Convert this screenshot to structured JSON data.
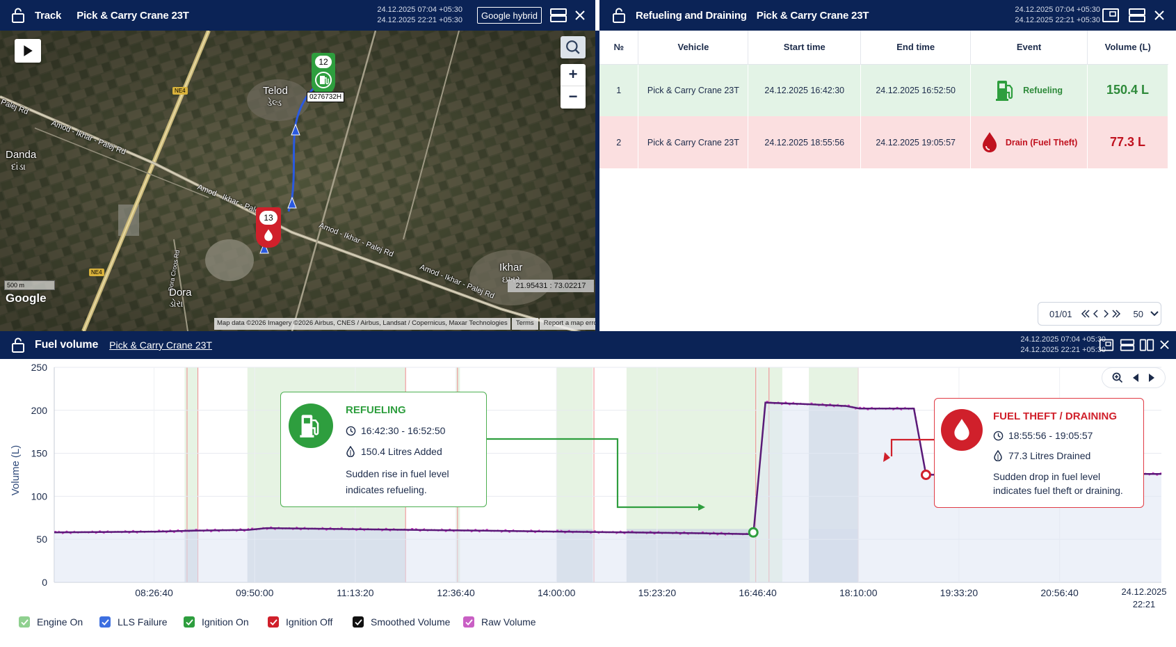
{
  "track": {
    "title": "Track",
    "vehicle": "Pick & Carry Crane 23T",
    "date_from": "24.12.2025 07:04 +05:30",
    "date_to": "24.12.2025 22:21 +05:30",
    "map_type": "Google hybrid",
    "map": {
      "places": [
        "Telod",
        "ડેલ્ડ",
        "Danda",
        "દાંડા",
        "Dora",
        "ડોરા",
        "Ikhar",
        "ઇખર"
      ],
      "roads": [
        "Palej Rd",
        "Amod - Ikhar - Palej Rd",
        "Amod - Ikhar - Palej Rd",
        "Amod - Ikhar - Palej Rd",
        "Amod - Ikhar - Palej Rd",
        "Dora Croos Rd",
        "NE4",
        "NE4"
      ],
      "marker_start": "12",
      "marker_end": "13",
      "plate": "0276732H",
      "scale": "500 m",
      "coords": "21.95431 : 73.02217",
      "attribution": "Map data ©2026 Imagery ©2026 Airbus, CNES / Airbus, Landsat / Copernicus, Maxar Technologies",
      "terms": "Terms",
      "report": "Report a map error",
      "google": "Google",
      "zoom_in": "+",
      "zoom_out": "−"
    }
  },
  "refuel": {
    "title": "Refueling and Draining",
    "vehicle": "Pick & Carry Crane 23T",
    "date_from": "24.12.2025 07:04 +05:30",
    "date_to": "24.12.2025 22:21 +05:30",
    "columns": [
      "№",
      "Vehicle",
      "Start time",
      "End time",
      "Event",
      "Volume (L)"
    ],
    "rows": [
      {
        "n": "1",
        "vehicle": "Pick & Carry Crane 23T",
        "start": "24.12.2025 16:42:30",
        "end": "24.12.2025 16:52:50",
        "event": "Refueling",
        "volume": "150.4 L"
      },
      {
        "n": "2",
        "vehicle": "Pick & Carry Crane 23T",
        "start": "24.12.2025 18:55:56",
        "end": "24.12.2025 19:05:57",
        "event": "Drain (Fuel Theft)",
        "volume": "77.3 L"
      }
    ],
    "pager": {
      "page": "01/01",
      "per_page": "50"
    }
  },
  "fuel": {
    "title": "Fuel volume",
    "vehicle": "Pick & Carry Crane 23T",
    "date_from": "24.12.2025 07:04 +05:30",
    "date_to": "24.12.2025 22:21 +05:30",
    "legend": [
      "Engine On",
      "LLS Failure",
      "Ignition On",
      "Ignition Off",
      "Smoothed Volume",
      "Raw Volume"
    ],
    "callout_refuel": {
      "title": "REFUELING",
      "time": "16:42:30 - 16:52:50",
      "amount": "150.4 Litres Added",
      "desc1": "Sudden rise in fuel level",
      "desc2": "indicates refueling."
    },
    "callout_drain": {
      "title": "FUEL THEFT / DRAINING",
      "time": "18:55:56 - 19:05:57",
      "amount": "77.3 Litres Drained",
      "desc1": "Sudden drop in fuel level",
      "desc2": "indicates fuel theft or draining."
    }
  },
  "colors": {
    "header": "#0b2356",
    "refuel": "#2e9e3e",
    "drain": "#d0202b",
    "line": "#5a1a78"
  },
  "chart_data": {
    "type": "line",
    "title": "",
    "xlabel": "",
    "ylabel": "Volume (L)",
    "ylim": [
      0,
      250
    ],
    "yticks": [
      "0",
      "50",
      "100",
      "150",
      "200",
      "250"
    ],
    "xticks": [
      "08:26:40",
      "09:50:00",
      "11:13:20",
      "12:36:40",
      "14:00:00",
      "15:23:20",
      "16:46:40",
      "18:10:00",
      "19:33:20",
      "20:56:40"
    ],
    "xend_label": [
      "24.12.2025",
      "22:21"
    ],
    "x": [
      "07:04",
      "08:30",
      "09:00",
      "09:45",
      "10:00",
      "11:00",
      "12:00",
      "13:00",
      "14:00",
      "15:00",
      "16:00",
      "16:40",
      "16:43",
      "16:53",
      "17:30",
      "18:00",
      "18:11",
      "18:56",
      "19:06",
      "20:00",
      "21:00",
      "22:21"
    ],
    "series": [
      {
        "name": "Smoothed Volume",
        "values": [
          58,
          59,
          60,
          61,
          63,
          62,
          61,
          60,
          59,
          58,
          57,
          56,
          55,
          209,
          207,
          205,
          202,
          202,
          125,
          126,
          126,
          126
        ]
      }
    ],
    "grid": true
  }
}
